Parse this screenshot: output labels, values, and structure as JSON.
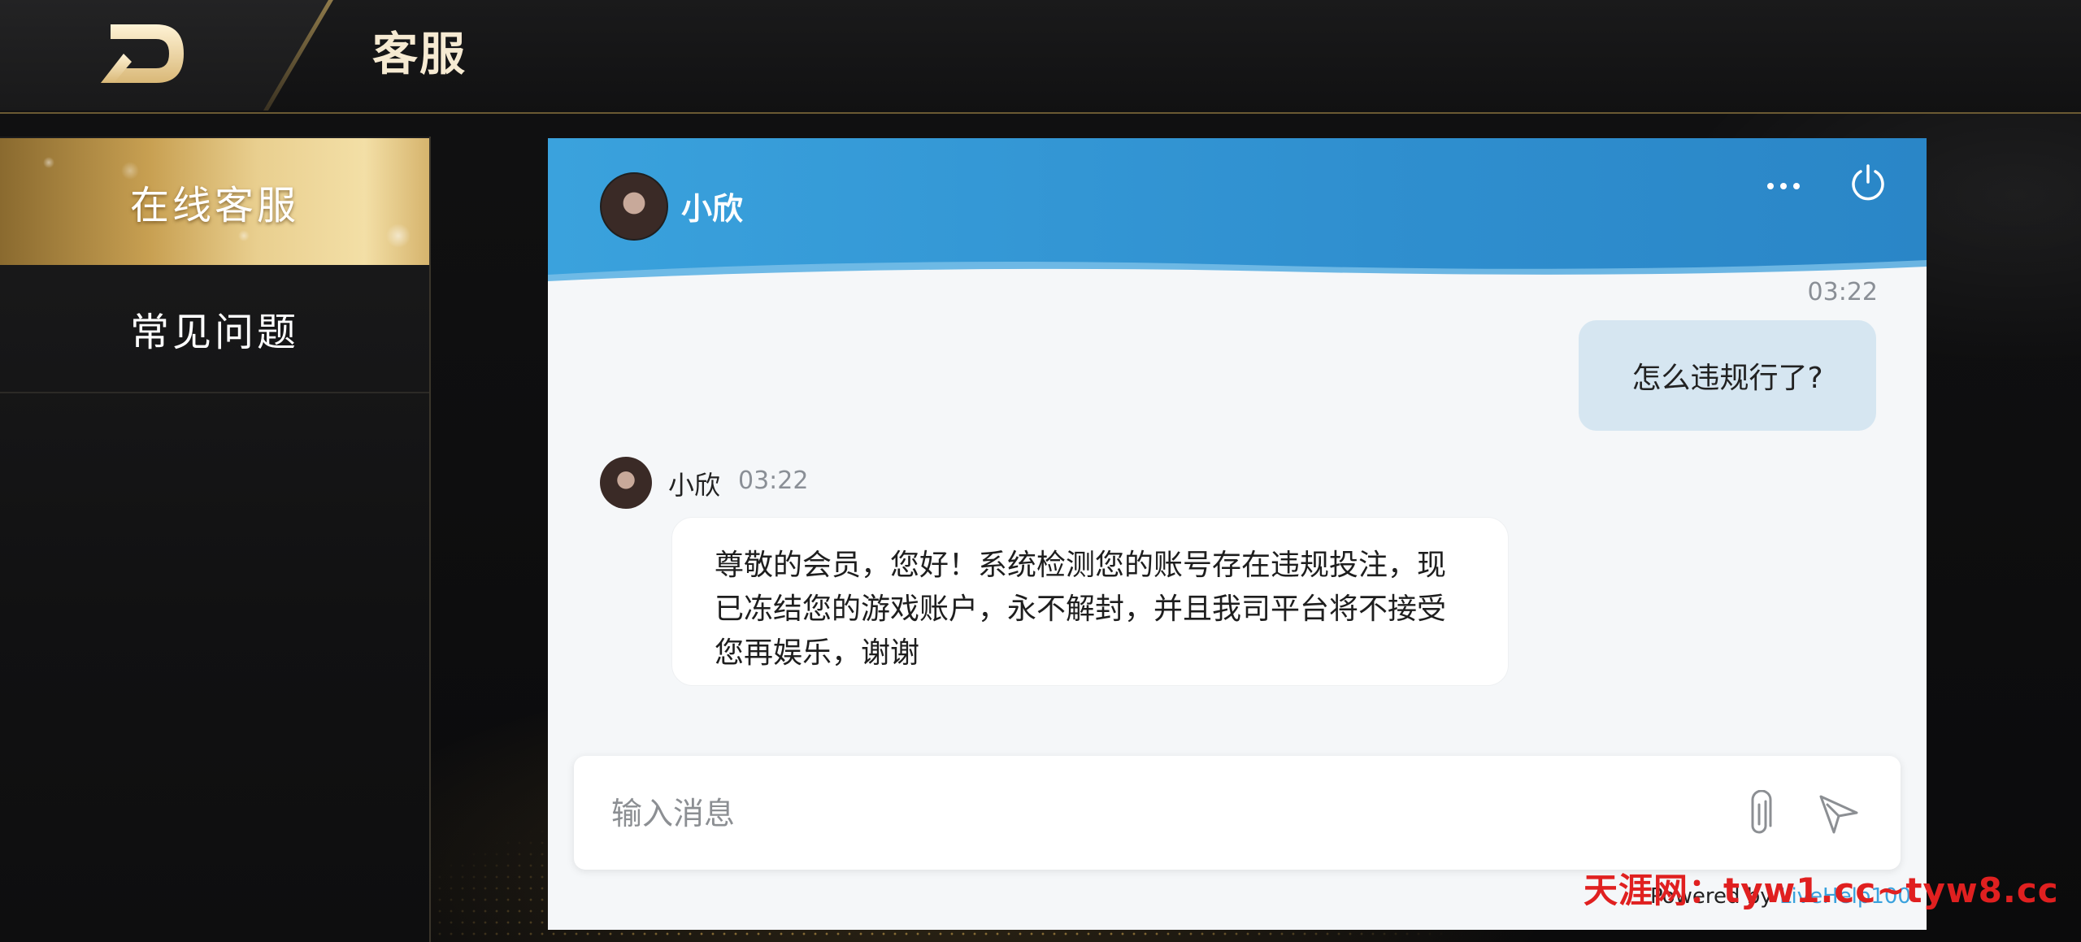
{
  "header": {
    "title": "客服"
  },
  "sidebar": {
    "items": [
      {
        "label": "在线客服",
        "active": true
      },
      {
        "label": "常见问题",
        "active": false
      }
    ]
  },
  "chat": {
    "agent_name": "小欣",
    "messages": [
      {
        "from": "user",
        "time": "03:22",
        "text": "怎么违规行了?"
      },
      {
        "from": "agent",
        "sender": "小欣",
        "time": "03:22",
        "text": "尊敬的会员，您好！系统检测您的账号存在违规投注，现已冻结您的游戏账户，永不解封，并且我司平台将不接受您再娱乐，谢谢"
      }
    ],
    "input_placeholder": "输入消息",
    "powered_prefix": "Powered by ",
    "powered_brand": "LiveHelp100"
  },
  "watermark": "天涯网：tyw1.cc~tyw8.cc",
  "colors": {
    "accent": "#3aa2dd",
    "gold": "#d6b46d",
    "user_bubble": "#d6e6f1"
  }
}
